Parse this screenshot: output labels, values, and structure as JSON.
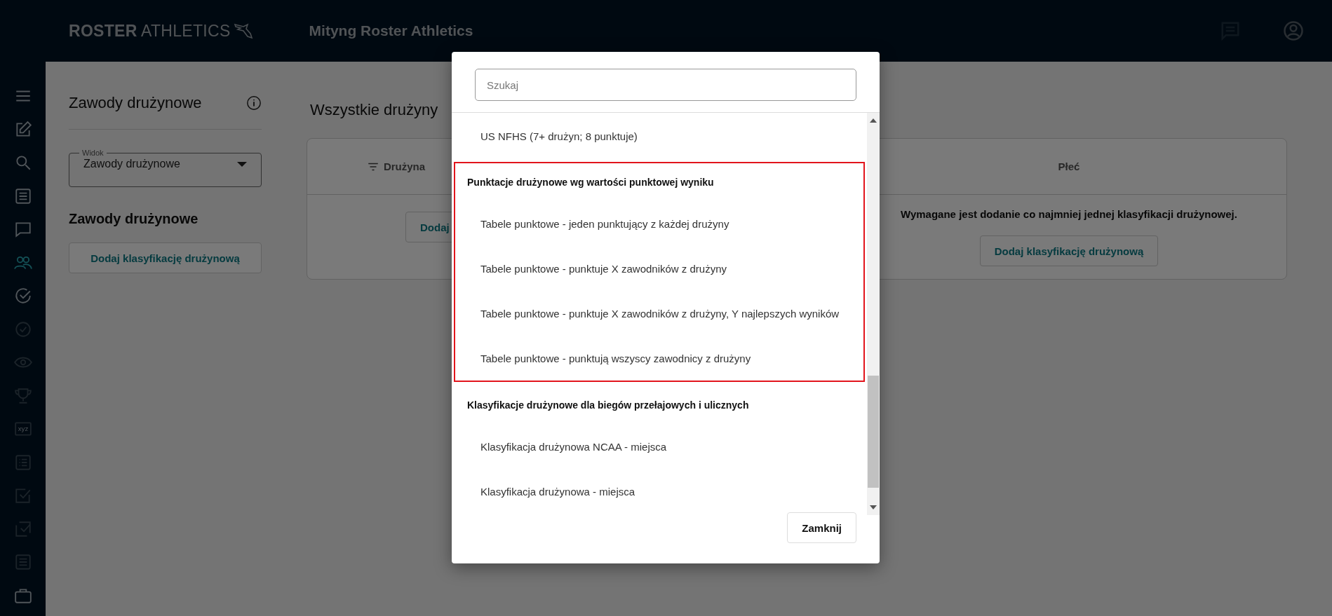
{
  "header": {
    "logo": {
      "bold": "ROSTER",
      "light": "ATHLETICS"
    },
    "title": "Mityng Roster Athletics"
  },
  "sidebar": {
    "items": [
      {
        "kind": "menu",
        "selected": false,
        "disabled": false
      },
      {
        "kind": "edit",
        "selected": false,
        "disabled": false
      },
      {
        "kind": "search",
        "selected": false,
        "disabled": false
      },
      {
        "kind": "list",
        "selected": false,
        "disabled": false
      },
      {
        "kind": "chat",
        "selected": false,
        "disabled": false
      },
      {
        "kind": "people",
        "selected": true,
        "disabled": false
      },
      {
        "kind": "check-circle",
        "selected": false,
        "disabled": false
      },
      {
        "kind": "clock-check",
        "selected": false,
        "disabled": true
      },
      {
        "kind": "eye",
        "selected": false,
        "disabled": true
      },
      {
        "kind": "trophy",
        "selected": false,
        "disabled": true
      },
      {
        "kind": "tag",
        "label": "xyz",
        "selected": false,
        "disabled": true
      },
      {
        "kind": "bullets",
        "selected": false,
        "disabled": true
      },
      {
        "kind": "checkbox",
        "selected": false,
        "disabled": true
      },
      {
        "kind": "multi-check",
        "selected": false,
        "disabled": true
      },
      {
        "kind": "list",
        "selected": false,
        "disabled": true
      },
      {
        "kind": "briefcase",
        "selected": false,
        "disabled": false
      }
    ]
  },
  "side_panel": {
    "title": "Zawody drużynowe",
    "view_select": {
      "label": "Widok",
      "value": "Zawody drużynowe"
    },
    "heading": "Zawody drużynowe",
    "add_button": "Dodaj klasyfikację drużynową"
  },
  "main": {
    "title": "Wszystkie drużyny",
    "table": {
      "columns": [
        {
          "label": "Drużyna",
          "filter": true
        },
        {
          "label": "Płeć",
          "filter": false
        }
      ],
      "partial_button": "Dodaj",
      "message": "Wymagane jest dodanie co najmniej jednej klasyfikacji drużynowej.",
      "add_button": "Dodaj klasyfikację drużynową"
    }
  },
  "dialog": {
    "search": {
      "placeholder": "Szukaj"
    },
    "items": [
      {
        "kind": "option",
        "label": "US NFHS (7+ drużyn; 8 punktuje)"
      },
      {
        "kind": "group",
        "label": "Punktacje drużynowe wg wartości punktowej wyniku",
        "highlighted": true,
        "children": [
          {
            "kind": "option",
            "label": "Tabele punktowe - jeden punktujący z każdej drużyny"
          },
          {
            "kind": "option",
            "label": "Tabele punktowe - punktuje X zawodników z drużyny"
          },
          {
            "kind": "option",
            "label": "Tabele punktowe - punktuje X zawodników z drużyny, Y najlepszych wyników"
          },
          {
            "kind": "option",
            "label": "Tabele punktowe - punktują wszyscy zawodnicy z drużyny"
          }
        ]
      },
      {
        "kind": "group",
        "label": "Klasyfikacje drużynowe dla biegów przełajowych i ulicznych",
        "highlighted": false,
        "children": [
          {
            "kind": "option",
            "label": "Klasyfikacja drużynowa NCAA - miejsca"
          },
          {
            "kind": "option",
            "label": "Klasyfikacja drużynowa - miejsca"
          }
        ]
      }
    ],
    "close_button": "Zamknij"
  }
}
